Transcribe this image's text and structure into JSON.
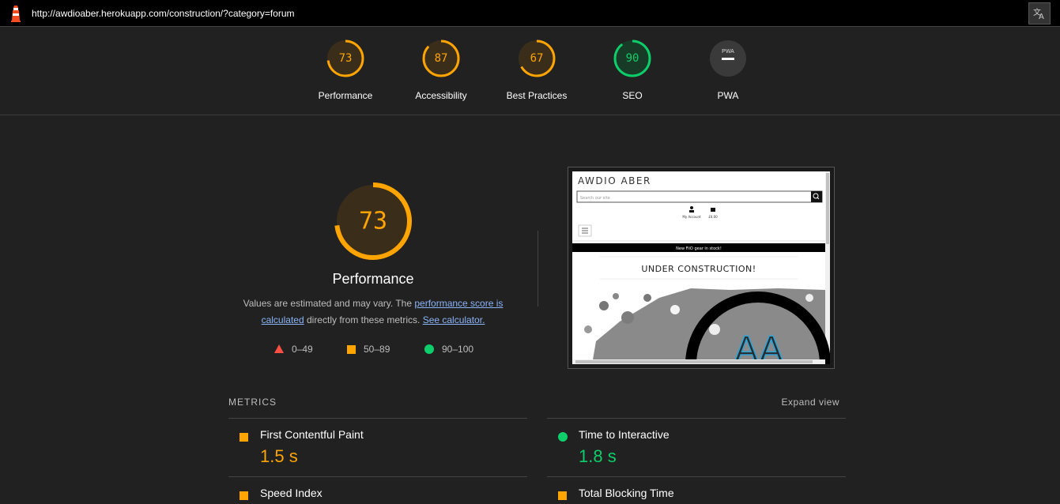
{
  "url": "http://awdioaber.herokuapp.com/construction/?category=forum",
  "colors": {
    "average": "#ffa400",
    "pass": "#0cce6b",
    "fail": "#ff4e42",
    "pwa_gray": "#9e9e9e",
    "link": "#8ab4f8"
  },
  "summary": [
    {
      "score": "73",
      "label": "Performance",
      "value": 73,
      "status": "average"
    },
    {
      "score": "87",
      "label": "Accessibility",
      "value": 87,
      "status": "average"
    },
    {
      "score": "67",
      "label": "Best Practices",
      "value": 67,
      "status": "average"
    },
    {
      "score": "90",
      "label": "SEO",
      "value": 90,
      "status": "pass"
    },
    {
      "score": "PWA",
      "label": "PWA",
      "value": null,
      "status": "na"
    }
  ],
  "performance": {
    "score": "73",
    "value": 73,
    "title": "Performance",
    "desc_prefix": "Values are estimated and may vary. The ",
    "desc_link1": "performance score is calculated",
    "desc_middle": " directly from these metrics. ",
    "desc_link2": "See calculator."
  },
  "legend": [
    {
      "range": "0–49",
      "icon": "triangle-icon"
    },
    {
      "range": "50–89",
      "icon": "square-icon"
    },
    {
      "range": "90–100",
      "icon": "circle-icon"
    }
  ],
  "screenshot": {
    "site_title": "AWDIO ABER",
    "search_placeholder": "Search our site",
    "account_label": "My Account",
    "cart_label": "£0.00",
    "banner": "New FiiO gear in stock!",
    "heading": "UNDER CONSTRUCTION!",
    "logo_text": "AA"
  },
  "metrics": {
    "header": "METRICS",
    "expand": "Expand view",
    "items": [
      {
        "name": "First Contentful Paint",
        "value": "1.5 s",
        "status": "average"
      },
      {
        "name": "Time to Interactive",
        "value": "1.8 s",
        "status": "pass"
      },
      {
        "name": "Speed Index",
        "value": "",
        "status": "average"
      },
      {
        "name": "Total Blocking Time",
        "value": "",
        "status": "average"
      }
    ]
  }
}
